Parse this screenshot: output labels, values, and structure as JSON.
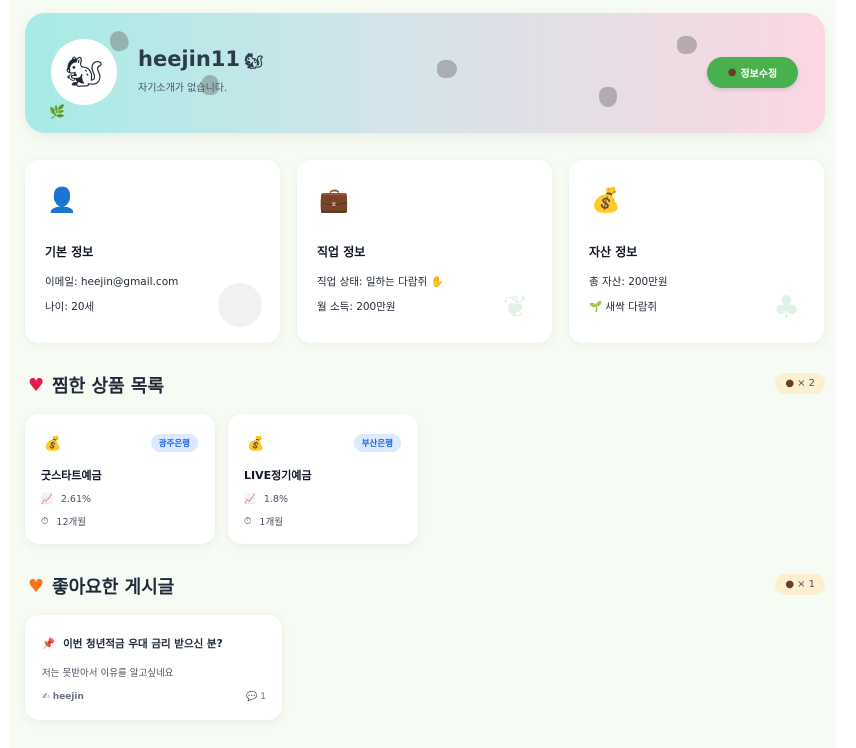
{
  "profile": {
    "avatar_icon": "squirrel",
    "username": "heejin11",
    "username_icon": "squirrel",
    "bio": "자기소개가 없습니다.",
    "edit_button_label": "정보수정",
    "edit_button_icon": "chestnut"
  },
  "info_cards": [
    {
      "icon": "person-silhouette",
      "title": "기본 정보",
      "line1": "이메일: heejin@gmail.com",
      "line2": "나이: 20세"
    },
    {
      "icon": "briefcase",
      "title": "직업 정보",
      "line1": "직업 상태: 일하는 다람쥐 ✋",
      "line2": "월 소득: 200만원"
    },
    {
      "icon": "money-bag",
      "title": "자산 정보",
      "line1": "총 자산: 200만원",
      "line2": "🌱 새싹 다람쥐"
    }
  ],
  "liked_products": {
    "title": "찜한 상품 목록",
    "count": "× 2",
    "items": [
      {
        "bank": "광주은행",
        "name": "굿스타트예금",
        "rate": "2.61%",
        "term": "12개월"
      },
      {
        "bank": "부산은행",
        "name": "LIVE정기예금",
        "rate": "1.8%",
        "term": "1개월"
      }
    ]
  },
  "liked_posts": {
    "title": "좋아요한 게시글",
    "count": "× 1",
    "items": [
      {
        "title": "이번 청년적금 우대 금리 받으신 분?",
        "body": "저는 못받아서 이유를 알고싶네요",
        "author": "heejin",
        "comments": "1"
      }
    ]
  },
  "colors": {
    "accent_green": "#48b14e",
    "bank_badge": "#2563eb",
    "count_pill": "#fcefcf"
  }
}
